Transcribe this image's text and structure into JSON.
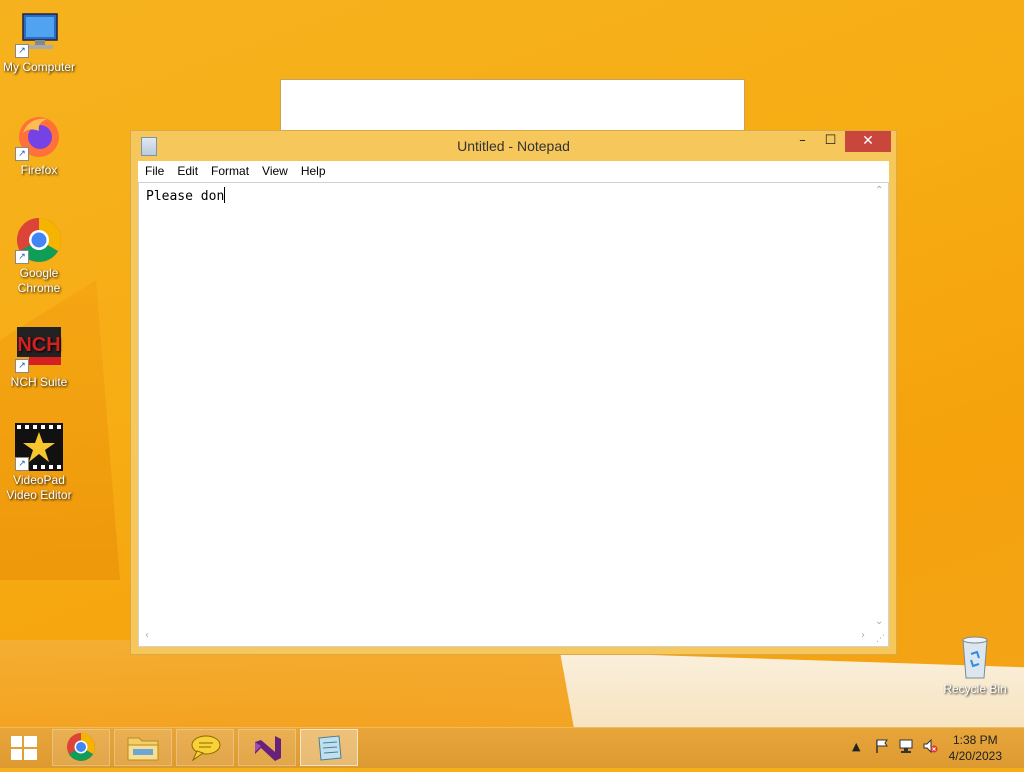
{
  "desktop": {
    "icons": [
      {
        "label": "My Computer",
        "icon": "my-computer-icon"
      },
      {
        "label": "Firefox",
        "icon": "firefox-icon"
      },
      {
        "label": "Google Chrome",
        "icon": "chrome-icon"
      },
      {
        "label": "NCH Suite",
        "icon": "nch-suite-icon"
      },
      {
        "label": "VideoPad Video Editor",
        "icon": "videopad-icon"
      },
      {
        "label": "Recycle Bin",
        "icon": "recycle-bin-icon"
      }
    ]
  },
  "notepad": {
    "title": "Untitled - Notepad",
    "menu": [
      "File",
      "Edit",
      "Format",
      "View",
      "Help"
    ],
    "content": "Please don",
    "controls": {
      "minimize": "–",
      "maximize": "☐",
      "close": "✕"
    }
  },
  "taskbar": {
    "apps": [
      {
        "name": "chrome",
        "icon": "chrome-icon"
      },
      {
        "name": "file-explorer",
        "icon": "folder-icon"
      },
      {
        "name": "speech",
        "icon": "speech-bubble-icon"
      },
      {
        "name": "visual-studio",
        "icon": "visual-studio-icon"
      },
      {
        "name": "notepad",
        "icon": "notepad-icon",
        "active": true
      }
    ],
    "clock": {
      "time": "1:38 PM",
      "date": "4/20/2023"
    }
  },
  "colors": {
    "accent": "#f6c75a",
    "close": "#c9463d",
    "taskbar": "#e0a035"
  }
}
